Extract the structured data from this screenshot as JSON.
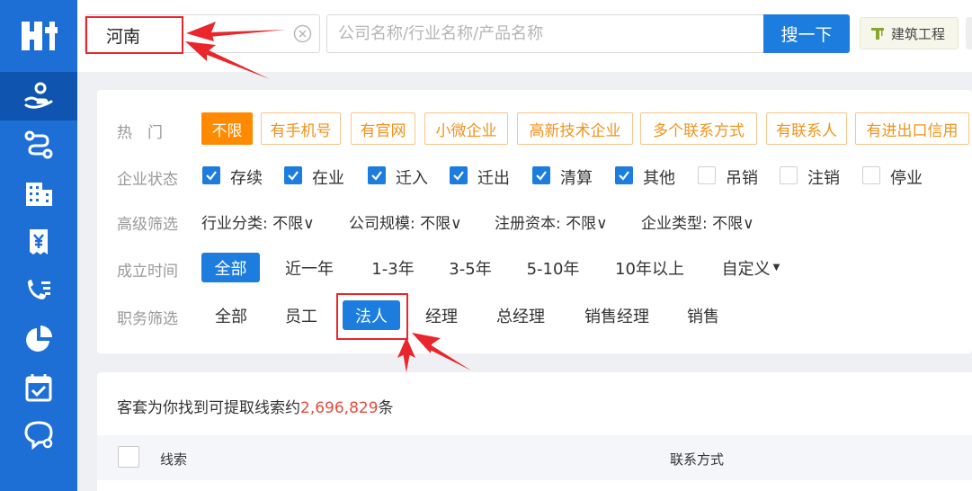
{
  "sidebar": {
    "logo_icon": "brand-logo-icon",
    "items": [
      {
        "icon": "customer-hand-icon",
        "active": true
      },
      {
        "icon": "route-icon",
        "active": false
      },
      {
        "icon": "building-icon",
        "active": false
      },
      {
        "icon": "invoice-yen-icon",
        "active": false
      },
      {
        "icon": "phone-list-icon",
        "active": false
      },
      {
        "icon": "pie-chart-icon",
        "active": false
      },
      {
        "icon": "calendar-check-icon",
        "active": false
      },
      {
        "icon": "chat-icon",
        "active": false
      }
    ]
  },
  "search": {
    "region_value": "河南",
    "keyword_placeholder": "公司名称/行业名称/产品名称",
    "button_label": "搜一下",
    "industry_tag": "建筑工程"
  },
  "filters": {
    "hot": {
      "label": "热　门",
      "tags": [
        "不限",
        "有手机号",
        "有官网",
        "小微企业",
        "高新技术企业",
        "多个联系方式",
        "有联系人",
        "有进出口信用"
      ],
      "selected_index": 0
    },
    "status": {
      "label": "企业状态",
      "options": [
        {
          "label": "存续",
          "checked": true
        },
        {
          "label": "在业",
          "checked": true
        },
        {
          "label": "迁入",
          "checked": true
        },
        {
          "label": "迁出",
          "checked": true
        },
        {
          "label": "清算",
          "checked": true
        },
        {
          "label": "其他",
          "checked": true
        },
        {
          "label": "吊销",
          "checked": false
        },
        {
          "label": "注销",
          "checked": false
        },
        {
          "label": "停业",
          "checked": false
        }
      ]
    },
    "advanced": {
      "label": "高级筛选",
      "items": [
        "行业分类: 不限",
        "公司规模: 不限",
        "注册资本: 不限",
        "企业类型: 不限"
      ]
    },
    "founded": {
      "label": "成立时间",
      "options": [
        "全部",
        "近一年",
        "1-3年",
        "3-5年",
        "5-10年",
        "10年以上",
        "自定义"
      ],
      "selected_index": 0
    },
    "position": {
      "label": "职务筛选",
      "options": [
        "全部",
        "员工",
        "法人",
        "经理",
        "总经理",
        "销售经理",
        "销售"
      ],
      "selected_index": 2
    }
  },
  "results": {
    "prefix": "客套为你找到可提取线索约",
    "count": "2,696,829",
    "suffix": "条",
    "columns": [
      "线索",
      "联系方式"
    ]
  },
  "colors": {
    "sidebar": "#1d6fd6",
    "primary": "#1d7ddf",
    "hot_orange": "#ff8a00",
    "annotation_red": "#e8262c",
    "count_red": "#e84b3c"
  }
}
